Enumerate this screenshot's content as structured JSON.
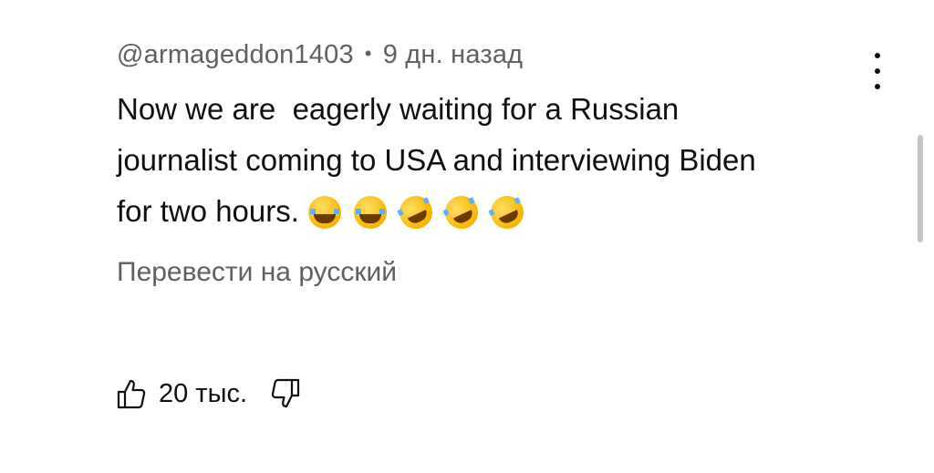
{
  "comment": {
    "author": "@armageddon1403",
    "separator": "•",
    "time_ago": "9 дн. назад",
    "text_lines": [
      "Now we are  eagerly waiting for a Russian",
      "journalist coming to USA and interviewing Biden",
      "for two hours."
    ],
    "emojis": [
      "joy-emoji",
      "joy-emoji",
      "rofl-emoji",
      "rofl-emoji",
      "rofl-emoji"
    ],
    "translate_label": "Перевести на русский",
    "like_count": "20 тыс."
  },
  "icons": {
    "menu": "more-vert-icon",
    "like": "thumbs-up-icon",
    "dislike": "thumbs-down-icon"
  },
  "colors": {
    "text": "#0f0f0f",
    "secondary_text": "#606060",
    "scrollbar": "#c4c4c4"
  }
}
